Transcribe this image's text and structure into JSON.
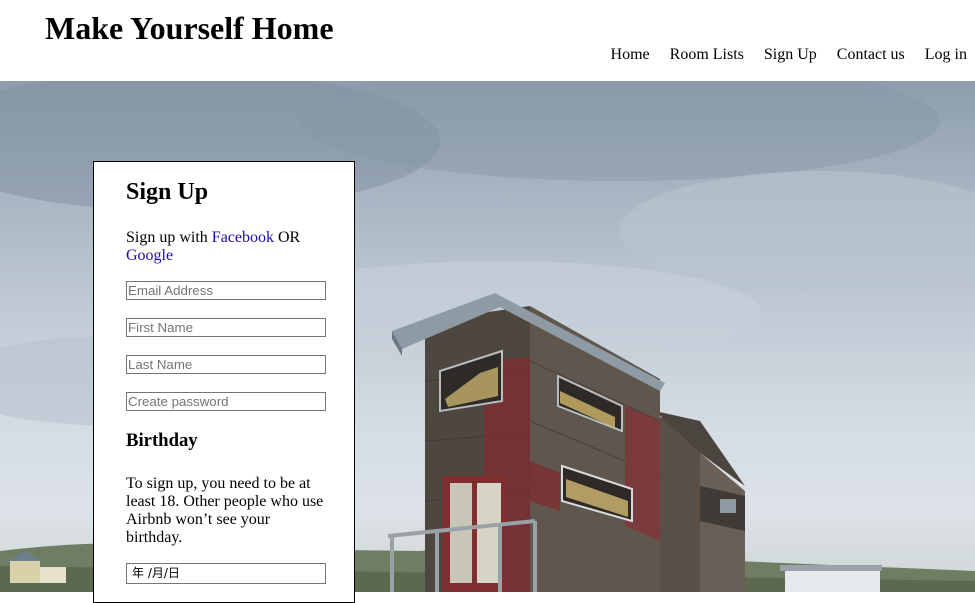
{
  "header": {
    "site_title": "Make Yourself Home",
    "nav": [
      "Home",
      "Room Lists",
      "Sign Up",
      "Contact us",
      "Log in"
    ]
  },
  "hero": {
    "image": "tiny-wooden-house-photo"
  },
  "signup": {
    "title": "Sign Up",
    "social_prefix": "Sign up with ",
    "facebook_label": "Facebook",
    "or_text": " OR ",
    "google_label": "Google",
    "fields": {
      "email_placeholder": "Email Address",
      "first_name_placeholder": "First Name",
      "last_name_placeholder": "Last Name",
      "password_placeholder": "Create password"
    },
    "birthday_title": "Birthday",
    "age_note": "To sign up, you need to be at least 18. Other people who use Airbnb won’t see your birthday.",
    "date_value": "年  /月/日"
  },
  "colors": {
    "link": "#1a0dab",
    "card_border": "#000000"
  }
}
